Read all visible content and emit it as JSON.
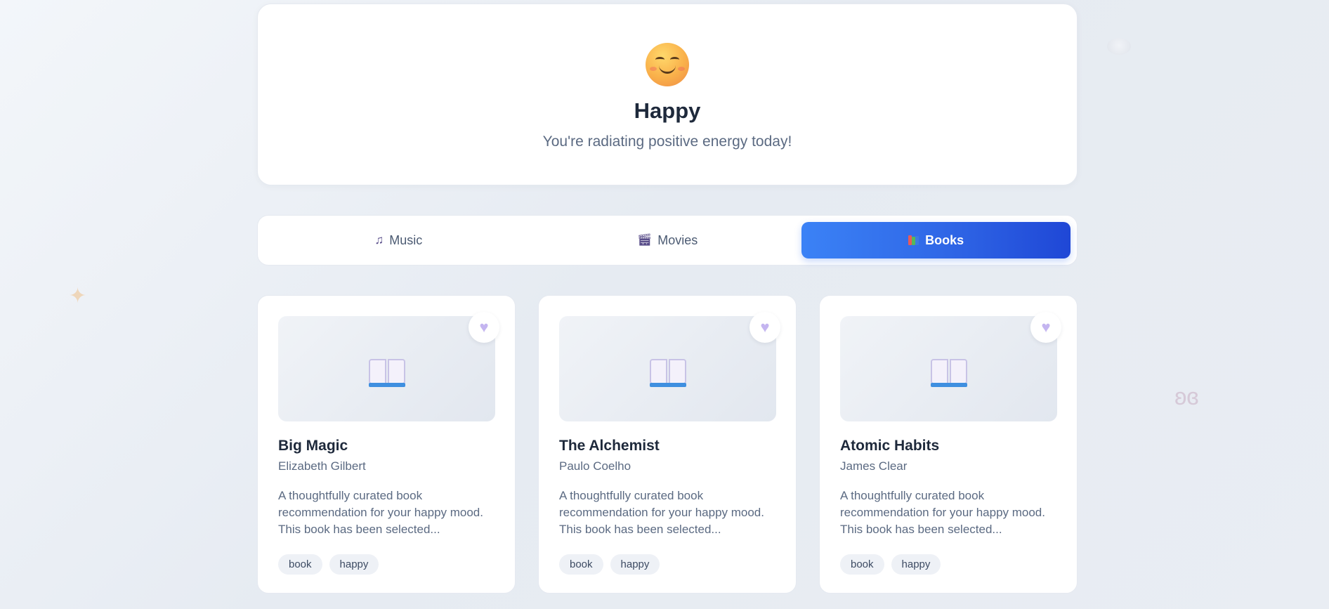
{
  "mood": {
    "emoji_icon": "smiling-face-icon",
    "title": "Happy",
    "subtitle": "You're radiating positive energy today!"
  },
  "tabs": [
    {
      "label": "Music",
      "icon": "music-note-icon",
      "active": false
    },
    {
      "label": "Movies",
      "icon": "clapperboard-icon",
      "active": false
    },
    {
      "label": "Books",
      "icon": "books-icon",
      "active": true
    }
  ],
  "colors": {
    "accent_start": "#3b82f6",
    "accent_end": "#1f47d6",
    "heart": "#c4b5f0"
  },
  "cards": [
    {
      "title": "Big Magic",
      "author": "Elizabeth Gilbert",
      "description": "A thoughtfully curated book recommendation for your happy mood. This book has been selected...",
      "tags": [
        "book",
        "happy"
      ]
    },
    {
      "title": "The Alchemist",
      "author": "Paulo Coelho",
      "description": "A thoughtfully curated book recommendation for your happy mood. This book has been selected...",
      "tags": [
        "book",
        "happy"
      ]
    },
    {
      "title": "Atomic Habits",
      "author": "James Clear",
      "description": "A thoughtfully curated book recommendation for your happy mood. This book has been selected...",
      "tags": [
        "book",
        "happy"
      ]
    }
  ]
}
